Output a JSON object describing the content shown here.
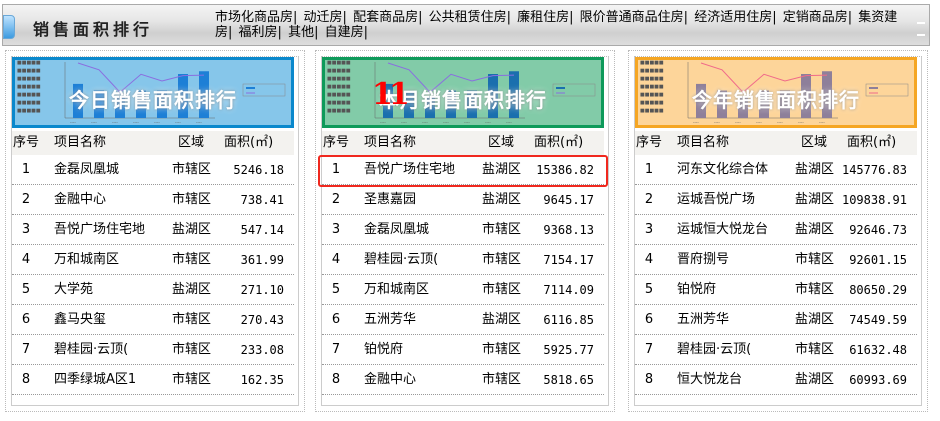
{
  "header": {
    "title": "销售面积排行",
    "links": [
      "市场化商品房|",
      "动迁房|",
      "配套商品房|",
      "公共租赁住房|",
      "廉租住房|",
      "限价普通商品住房|",
      "经济适用住房|",
      "定销商品房|",
      "集资建房|",
      "福利房|",
      "其他|",
      "自建房|"
    ]
  },
  "columns": {
    "rank": "序号",
    "name": "项目名称",
    "district": "区域",
    "area": "面积(㎡)"
  },
  "panels": [
    {
      "title": "今日销售面积排行",
      "color": "#0a88cc",
      "bg": "#86c6ea",
      "bar": "#1d7fd6",
      "line": "#8a6ee0",
      "rows": [
        [
          "1",
          "金磊凤凰城",
          "市辖区",
          "5246.18"
        ],
        [
          "2",
          "金融中心",
          "市辖区",
          "738.41"
        ],
        [
          "3",
          "吾悦广场住宅地",
          "盐湖区",
          "547.14"
        ],
        [
          "4",
          "万和城南区",
          "市辖区",
          "361.99"
        ],
        [
          "5",
          "大学苑",
          "盐湖区",
          "271.10"
        ],
        [
          "6",
          "鑫马央玺",
          "市辖区",
          "270.43"
        ],
        [
          "7",
          "碧桂园·云顶(",
          "市辖区",
          "233.08"
        ],
        [
          "8",
          "四季绿城A区1",
          "市辖区",
          "162.35"
        ]
      ]
    },
    {
      "title": "本月销售面积排行",
      "color": "#0e9a5a",
      "bg": "#82cba8",
      "bar": "#1a6fae",
      "line": "#8a6ee0",
      "marker": "11",
      "rows": [
        [
          "1",
          "吾悦广场住宅地",
          "盐湖区",
          "15386.82"
        ],
        [
          "2",
          "圣惠嘉园",
          "盐湖区",
          "9645.17"
        ],
        [
          "3",
          "金磊凤凰城",
          "市辖区",
          "9368.13"
        ],
        [
          "4",
          "碧桂园·云顶(",
          "市辖区",
          "7154.17"
        ],
        [
          "5",
          "万和城南区",
          "市辖区",
          "7114.09"
        ],
        [
          "6",
          "五洲芳华",
          "盐湖区",
          "6116.85"
        ],
        [
          "7",
          "铂悦府",
          "市辖区",
          "5925.77"
        ],
        [
          "8",
          "金融中心",
          "市辖区",
          "5818.65"
        ]
      ]
    },
    {
      "title": "今年销售面积排行",
      "color": "#f5a623",
      "bg": "#fdd59a",
      "bar": "#8e7f9a",
      "line": "#f06a8a",
      "rows": [
        [
          "1",
          "河东文化综合体",
          "盐湖区",
          "145776.83"
        ],
        [
          "2",
          "运城吾悦广场",
          "盐湖区",
          "109838.91"
        ],
        [
          "3",
          "运城恒大悦龙台",
          "盐湖区",
          "92646.73"
        ],
        [
          "4",
          "晋府捌号",
          "市辖区",
          "92601.15"
        ],
        [
          "5",
          "铂悦府",
          "市辖区",
          "80650.29"
        ],
        [
          "6",
          "五洲芳华",
          "盐湖区",
          "74549.59"
        ],
        [
          "7",
          "碧桂园·云顶(",
          "市辖区",
          "61632.48"
        ],
        [
          "8",
          "恒大悦龙台",
          "盐湖区",
          "60993.69"
        ]
      ]
    }
  ]
}
